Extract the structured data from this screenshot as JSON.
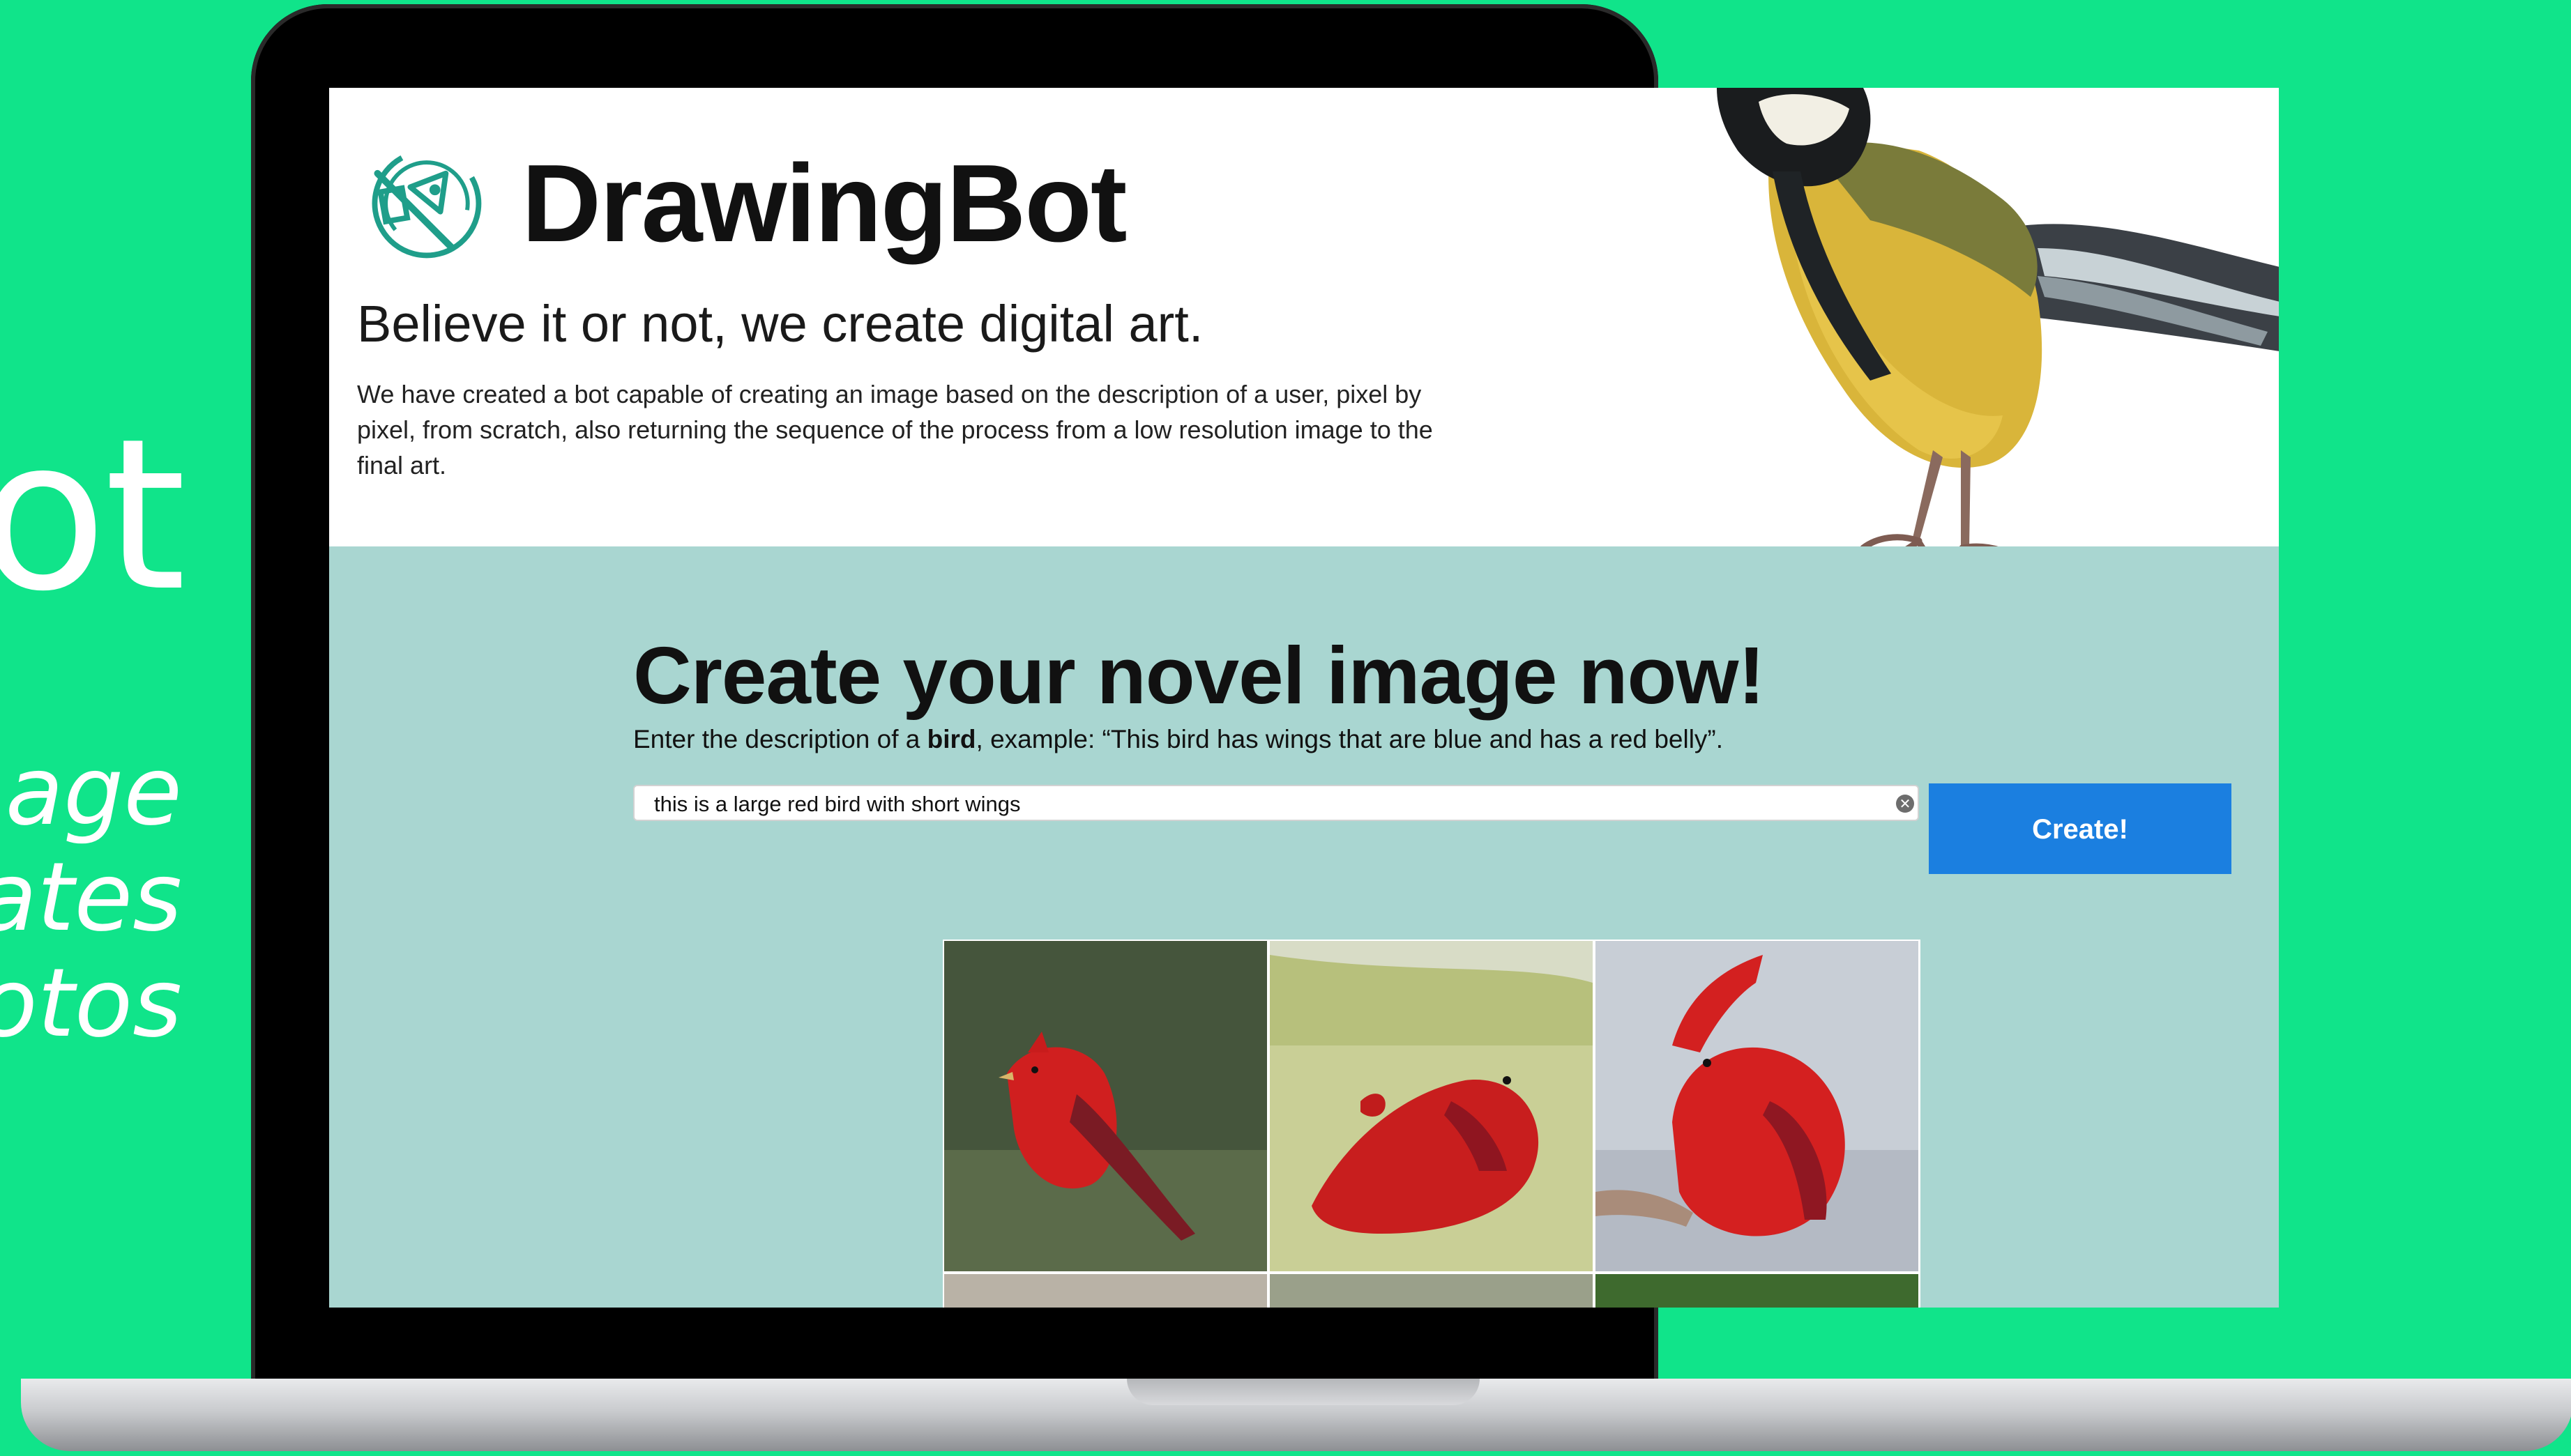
{
  "side": {
    "title_fragment": "ot",
    "tagline": [
      "age",
      "ates",
      "otos"
    ]
  },
  "hero": {
    "brand": "DrawingBot",
    "tagline": "Believe it or not, we create digital art.",
    "intro": "We have created a bot capable of creating an image based on the description of a user, pixel by pixel, from scratch, also returning the sequence of the process from a low resolution image to the final art."
  },
  "main": {
    "title": "Create your novel image now!",
    "desc_prefix": "Enter the description of a ",
    "desc_bold": "bird",
    "desc_suffix": ", example: “This bird has wings that are blue and has a red belly”.",
    "input_value": "this is a large red bird with short wings",
    "create_label": "Create!"
  },
  "gallery": {
    "tiles": [
      "red-bird-dark-background",
      "red-bird-green-background",
      "red-bird-grey-background",
      "partial-tile",
      "partial-tile",
      "partial-tile"
    ]
  },
  "colors": {
    "page_background": "#10e48a",
    "main_background": "#a9d6d1",
    "button": "#1b7fe0",
    "logo": "#1f9e8a"
  }
}
